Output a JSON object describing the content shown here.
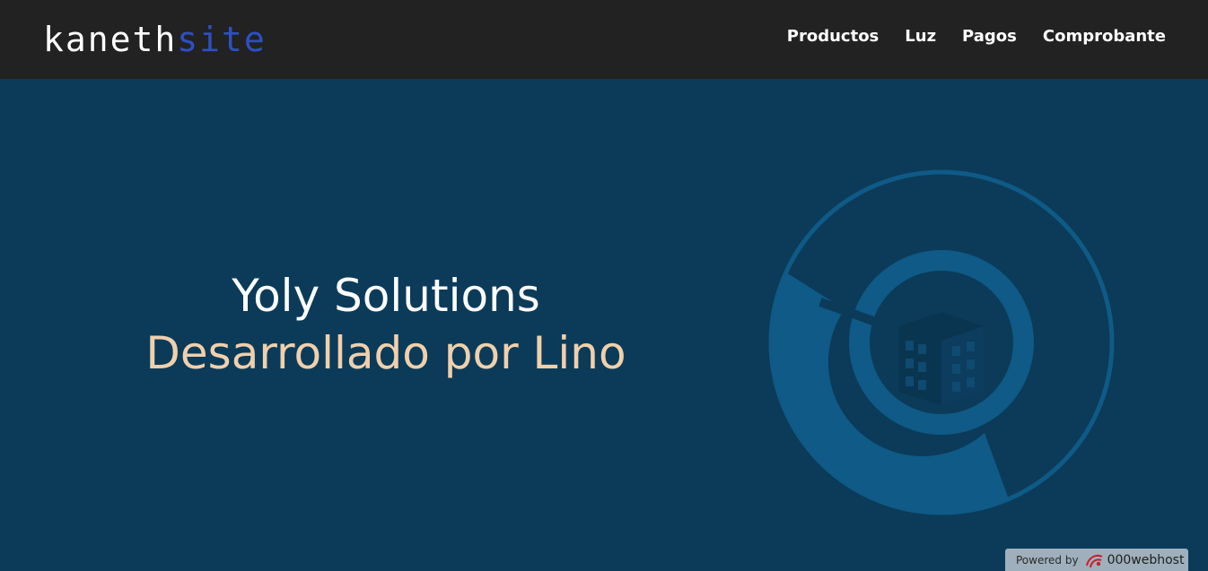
{
  "brand": {
    "logo_part_1": "kaneth",
    "logo_part_2": "site"
  },
  "nav": {
    "items": [
      {
        "label": "Productos"
      },
      {
        "label": "Luz"
      },
      {
        "label": "Pagos"
      },
      {
        "label": "Comprobante"
      }
    ]
  },
  "hero": {
    "title": "Yoly Solutions",
    "subtitle": "Desarrollado por Lino",
    "graphic_icon": "building-icon"
  },
  "footer_badge": {
    "label": "Powered by",
    "brand": "000webhost",
    "icon": "000webhost-logo-icon"
  },
  "colors": {
    "navbar_bg": "#222222",
    "hero_bg": "#0b3b59",
    "accent_blue": "#2f4fc4",
    "subtitle": "#f0d0ac",
    "graphic": "#0f5a86"
  }
}
